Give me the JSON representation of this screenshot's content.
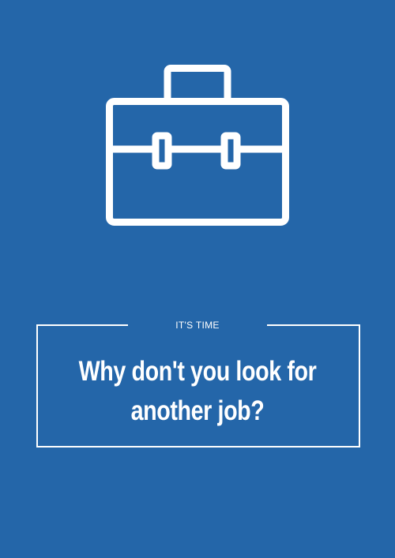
{
  "poster": {
    "background_color": "#2466a9",
    "foreground_color": "#ffffff",
    "icon": "briefcase-icon",
    "kicker": "IT'S TIME",
    "headline": "Why don't you look for another job?"
  }
}
